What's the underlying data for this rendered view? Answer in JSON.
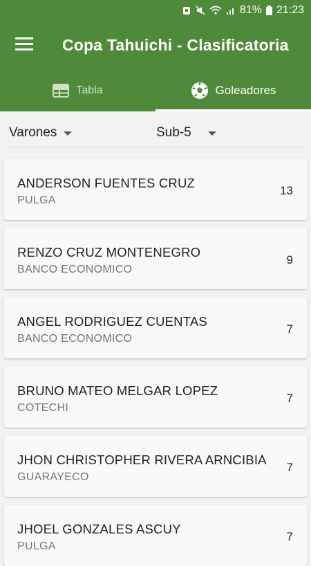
{
  "status_bar": {
    "battery": "81%",
    "time": "21:23"
  },
  "app_bar": {
    "title": "Copa Tahuichi - Clasificatoria"
  },
  "tabs": [
    {
      "label": "Tabla",
      "icon": "table-icon",
      "selected": false
    },
    {
      "label": "Goleadores",
      "icon": "soccer-ball-icon",
      "selected": true
    }
  ],
  "filters": {
    "gender": "Varones",
    "category": "Sub-5"
  },
  "scorers": [
    {
      "name": "ANDERSON FUENTES CRUZ",
      "team": "PULGA",
      "goals": "13"
    },
    {
      "name": "RENZO CRUZ MONTENEGRO",
      "team": "BANCO ECONOMICO",
      "goals": "9"
    },
    {
      "name": "ANGEL RODRIGUEZ CUENTAS",
      "team": "BANCO ECONOMICO",
      "goals": "7"
    },
    {
      "name": "BRUNO MATEO MELGAR LOPEZ",
      "team": "COTECHI",
      "goals": "7"
    },
    {
      "name": "JHON CHRISTOPHER RIVERA ARNCIBIA",
      "team": "GUARAYECO",
      "goals": "7"
    },
    {
      "name": "JHOEL GONZALES ASCUY",
      "team": "PULGA",
      "goals": "7"
    }
  ],
  "colors": {
    "primary": "#4f8a3a",
    "background": "#f2f2f2"
  }
}
